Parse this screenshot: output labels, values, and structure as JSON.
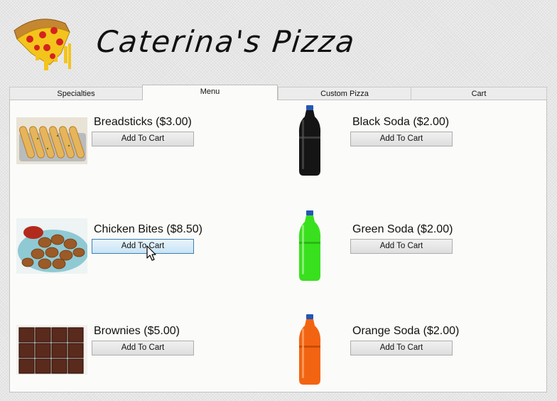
{
  "app": {
    "title": "Caterina's Pizza",
    "logo_icon": "pizza-slice-icon"
  },
  "tabs": [
    {
      "label": "Specialties",
      "active": false
    },
    {
      "label": "Menu",
      "active": true
    },
    {
      "label": "Custom Pizza",
      "active": false
    },
    {
      "label": "Cart",
      "active": false
    }
  ],
  "menu": {
    "items": [
      {
        "label": "Breadsticks ($3.00)",
        "button": "Add To Cart",
        "image": "breadsticks-photo"
      },
      {
        "label": "Chicken Bites ($8.50)",
        "button": "Add To Cart",
        "image": "chicken-bites-photo"
      },
      {
        "label": "Brownies ($5.00)",
        "button": "Add To Cart",
        "image": "brownies-photo"
      },
      {
        "label": "Black Soda ($2.00)",
        "button": "Add To Cart",
        "image": "black-soda-bottle",
        "color": "#151515"
      },
      {
        "label": "Green Soda ($2.00)",
        "button": "Add To Cart",
        "image": "green-soda-bottle",
        "color": "#39e01e"
      },
      {
        "label": "Orange Soda ($2.00)",
        "button": "Add To Cart",
        "image": "orange-soda-bottle",
        "color": "#f26412"
      }
    ]
  },
  "colors": {
    "hover_button_border": "#3c7fb1",
    "panel_bg": "#fbfbf9"
  }
}
